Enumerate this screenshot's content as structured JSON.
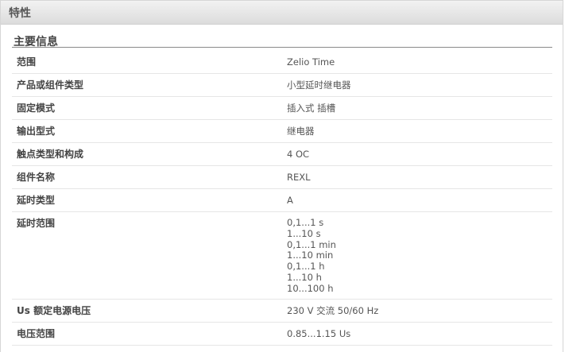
{
  "panel": {
    "title": "特性"
  },
  "section": {
    "title": "主要信息"
  },
  "rows": [
    {
      "label": "范围",
      "values": [
        "Zelio Time"
      ]
    },
    {
      "label": "产品或组件类型",
      "values": [
        "小型延时继电器"
      ]
    },
    {
      "label": "固定模式",
      "values": [
        "插入式 插槽"
      ]
    },
    {
      "label": "输出型式",
      "values": [
        "继电器"
      ]
    },
    {
      "label": "触点类型和构成",
      "values": [
        "4 OC"
      ]
    },
    {
      "label": "组件名称",
      "values": [
        "REXL"
      ]
    },
    {
      "label": "延时类型",
      "values": [
        "A"
      ]
    },
    {
      "label": "延时范围",
      "values": [
        "0,1...1 s",
        "1...10 s",
        "0,1...1 min",
        "1...10 min",
        "0,1...1 h",
        "1...10 h",
        "10...100 h"
      ]
    },
    {
      "label": "Us 额定电源电压",
      "values": [
        "230 V 交流 50/60 Hz"
      ]
    },
    {
      "label": "电压范围",
      "values": [
        "0.85...1.15 Us"
      ]
    }
  ]
}
